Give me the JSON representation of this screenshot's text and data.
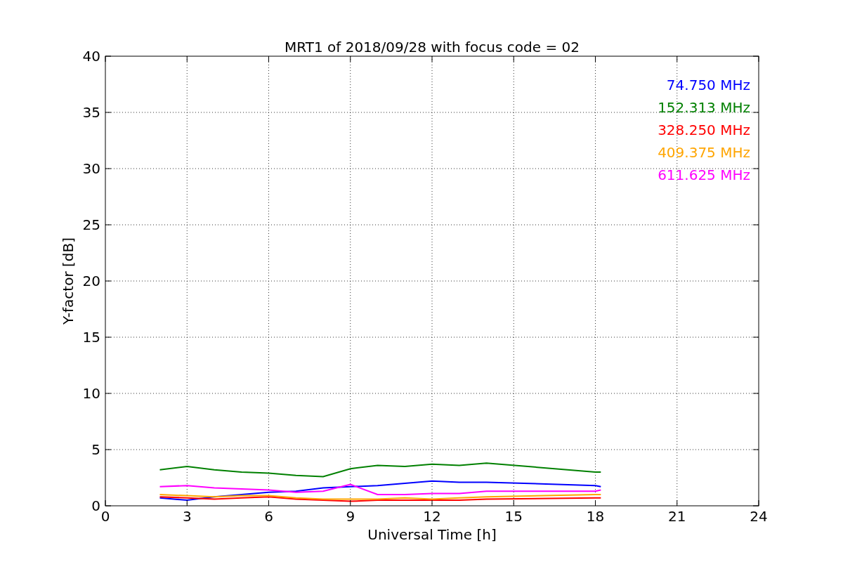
{
  "figure": {
    "chart_data": {
      "type": "line",
      "title": "MRT1 of 2018/09/28 with focus code = 02",
      "xlabel": "Universal Time [h]",
      "ylabel": "Y-factor [dB]",
      "x": [
        2,
        3,
        4,
        5,
        6,
        7,
        8,
        9,
        10,
        11,
        12,
        13,
        14,
        18,
        18.2
      ],
      "series": [
        {
          "name": "74.750 MHz",
          "color": "#0000ff",
          "values": [
            0.7,
            0.5,
            0.8,
            1.0,
            1.2,
            1.3,
            1.6,
            1.7,
            1.8,
            2.0,
            2.2,
            2.1,
            2.1,
            1.8,
            1.7
          ]
        },
        {
          "name": "152.313 MHz",
          "color": "#008000",
          "values": [
            3.2,
            3.5,
            3.2,
            3.0,
            2.9,
            2.7,
            2.6,
            3.3,
            3.6,
            3.5,
            3.7,
            3.6,
            3.8,
            3.0,
            3.0
          ]
        },
        {
          "name": "328.250 MHz",
          "color": "#ff0000",
          "values": [
            0.8,
            0.7,
            0.6,
            0.7,
            0.8,
            0.6,
            0.5,
            0.4,
            0.5,
            0.5,
            0.5,
            0.5,
            0.6,
            0.7,
            0.7
          ]
        },
        {
          "name": "409.375 MHz",
          "color": "#ffa500",
          "values": [
            1.0,
            0.9,
            0.8,
            0.9,
            0.9,
            0.7,
            0.6,
            0.6,
            0.6,
            0.7,
            0.6,
            0.7,
            0.8,
            1.0,
            1.0
          ]
        },
        {
          "name": "611.625 MHz",
          "color": "#ff00ff",
          "values": [
            1.7,
            1.8,
            1.6,
            1.5,
            1.4,
            1.2,
            1.3,
            1.9,
            1.0,
            1.0,
            1.1,
            1.1,
            1.3,
            1.3,
            1.4
          ]
        }
      ],
      "grid": true,
      "xlim": [
        0,
        24
      ],
      "ylim": [
        0,
        40
      ],
      "xticks": [
        0,
        3,
        6,
        9,
        12,
        15,
        18,
        21,
        24
      ],
      "yticks": [
        0,
        5,
        10,
        15,
        20,
        25,
        30,
        35,
        40
      ]
    }
  }
}
